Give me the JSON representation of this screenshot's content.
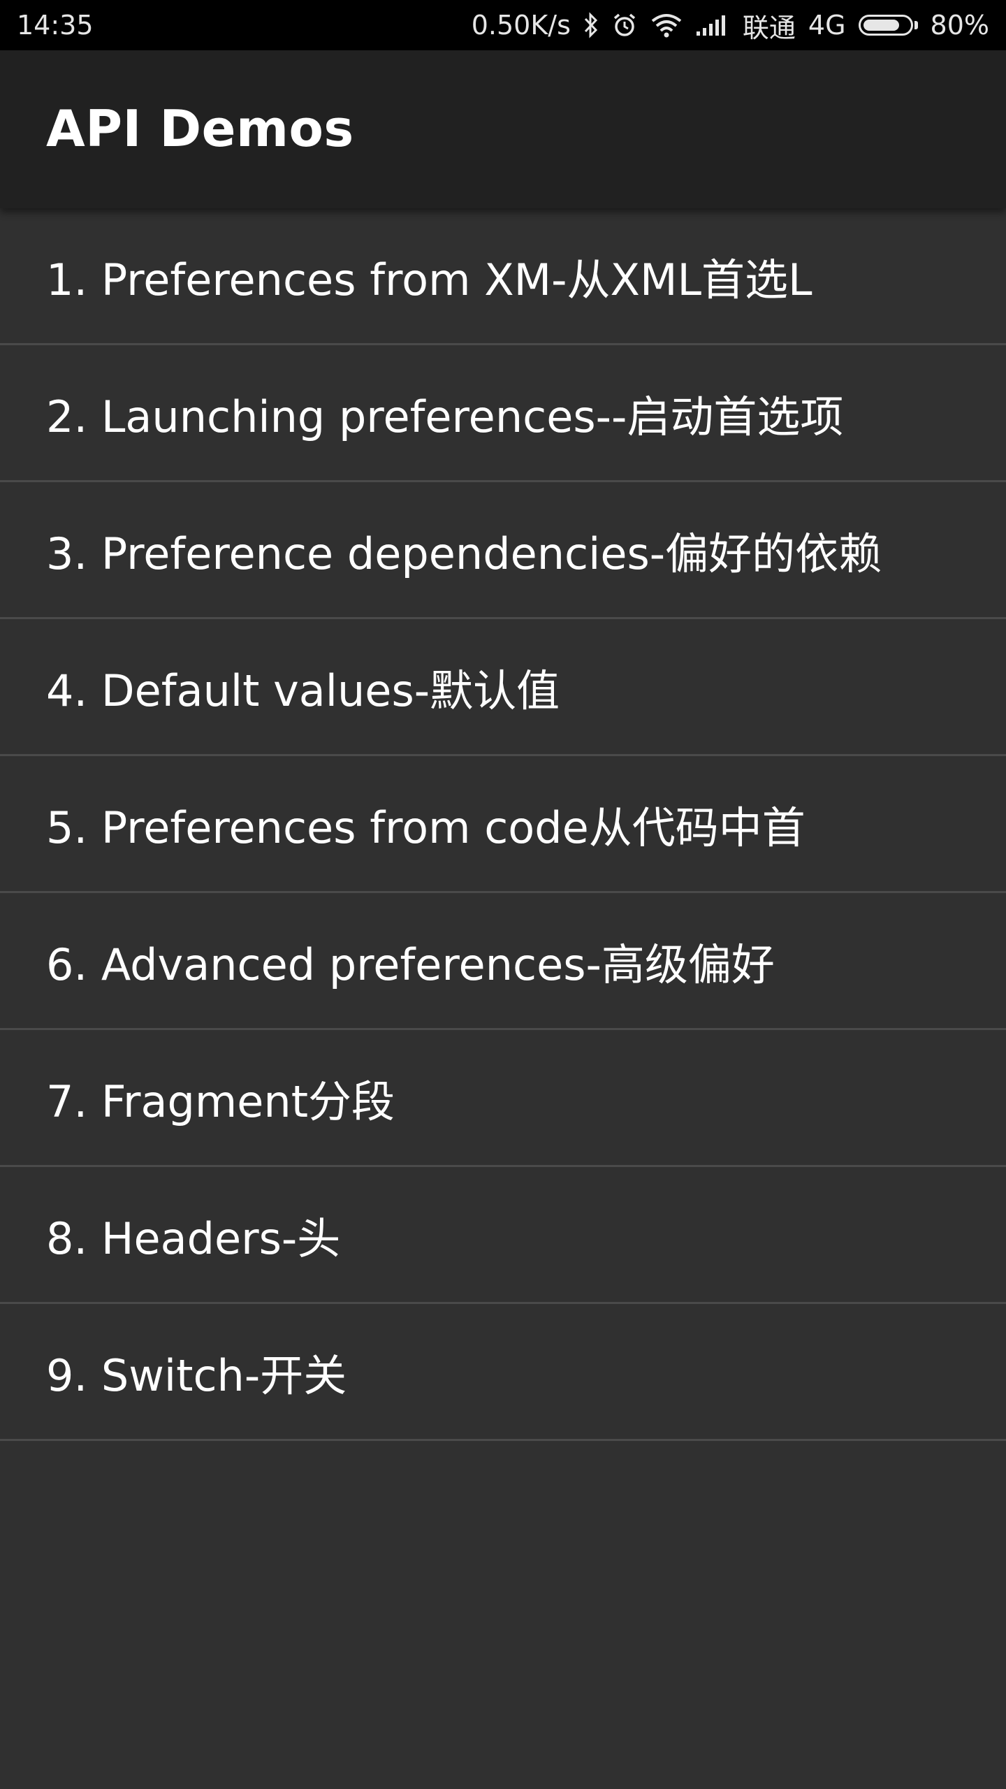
{
  "status_bar": {
    "time": "14:35",
    "network_speed": "0.50K/s",
    "carrier": "联通",
    "network_type": "4G",
    "battery_percent": "80%",
    "battery_level": 0.8,
    "icons": [
      "bluetooth-icon",
      "alarm-icon",
      "wifi-icon",
      "signal-icon",
      "battery-icon"
    ]
  },
  "app_bar": {
    "title": "API Demos"
  },
  "list": {
    "items": [
      {
        "label": "1. Preferences from XM-从XML首选L"
      },
      {
        "label": "2. Launching preferences--启动首选项"
      },
      {
        "label": "3. Preference dependencies-偏好的依赖"
      },
      {
        "label": "4. Default values-默认值"
      },
      {
        "label": "5. Preferences from code从代码中首"
      },
      {
        "label": "6. Advanced preferences-高级偏好"
      },
      {
        "label": "7. Fragment分段"
      },
      {
        "label": "8. Headers-头"
      },
      {
        "label": "9. Switch-开关"
      }
    ]
  },
  "colors": {
    "status_bar_bg": "#000000",
    "app_bar_bg": "#212121",
    "list_bg": "#303030",
    "divider": "#4a4a4a",
    "text": "#ffffff"
  }
}
